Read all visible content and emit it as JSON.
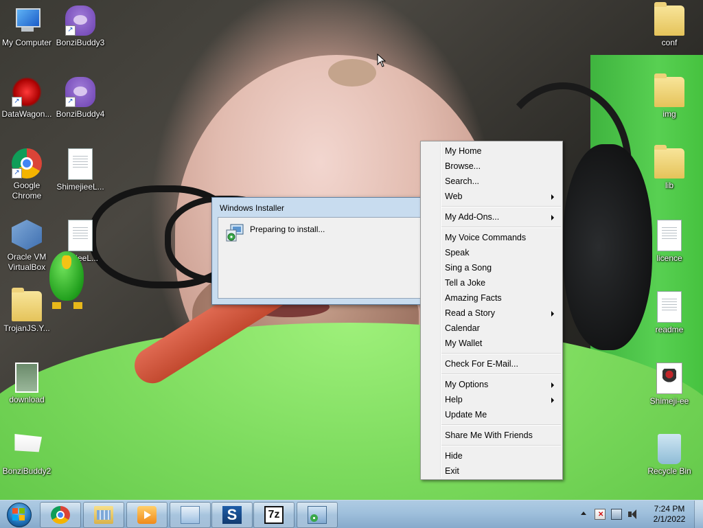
{
  "desktop": {
    "left_icons": [
      {
        "label": "My Computer",
        "icon": "computer-icon"
      },
      {
        "label": "BonziBuddy3",
        "icon": "bonzi-icon"
      },
      {
        "label": "DataWagon...",
        "icon": "web-icon"
      },
      {
        "label": "BonziBuddy4",
        "icon": "bonzi-icon"
      },
      {
        "label": "Google Chrome",
        "icon": "chrome-icon"
      },
      {
        "label": "ShimejieeL...",
        "icon": "document-icon"
      },
      {
        "label": "Oracle VM VirtualBox",
        "icon": "virtualbox-icon"
      },
      {
        "label": "...ejieeL...",
        "icon": "document-icon"
      },
      {
        "label": "TrojanJS.Y...",
        "icon": "folder-icon"
      },
      {
        "label": "download",
        "icon": "photo-icon"
      },
      {
        "label": "BonziBuddy2",
        "icon": "flag-icon"
      }
    ],
    "right_icons": [
      {
        "label": "conf",
        "icon": "folder-icon"
      },
      {
        "label": "img",
        "icon": "folder-icon"
      },
      {
        "label": "lib",
        "icon": "folder-icon"
      },
      {
        "label": "licence",
        "icon": "document-icon"
      },
      {
        "label": "readme",
        "icon": "document-icon"
      },
      {
        "label": "Shimeji-ee",
        "icon": "shimeji-icon"
      },
      {
        "label": "Recycle Bin",
        "icon": "recycle-bin-icon"
      }
    ]
  },
  "installer": {
    "title": "Windows Installer",
    "message": "Preparing to install..."
  },
  "context_menu": {
    "groups": [
      [
        {
          "label": "My Home",
          "submenu": false
        },
        {
          "label": "Browse...",
          "submenu": false
        },
        {
          "label": "Search...",
          "submenu": false
        },
        {
          "label": "Web",
          "submenu": true
        }
      ],
      [
        {
          "label": "My Add-Ons...",
          "submenu": true
        }
      ],
      [
        {
          "label": "My Voice Commands",
          "submenu": false
        },
        {
          "label": "Speak",
          "submenu": false
        },
        {
          "label": "Sing a Song",
          "submenu": false
        },
        {
          "label": "Tell a Joke",
          "submenu": false
        },
        {
          "label": "Amazing Facts",
          "submenu": false
        },
        {
          "label": "Read a Story",
          "submenu": true
        },
        {
          "label": "Calendar",
          "submenu": false
        },
        {
          "label": "My Wallet",
          "submenu": false
        }
      ],
      [
        {
          "label": "Check For E-Mail...",
          "submenu": false
        }
      ],
      [
        {
          "label": "My Options",
          "submenu": true
        },
        {
          "label": "Help",
          "submenu": true
        },
        {
          "label": "Update Me",
          "submenu": false
        }
      ],
      [
        {
          "label": "Share Me With Friends",
          "submenu": false
        }
      ],
      [
        {
          "label": "Hide",
          "submenu": false
        },
        {
          "label": "Exit",
          "submenu": false
        }
      ]
    ]
  },
  "taskbar": {
    "pinned": [
      {
        "name": "chrome",
        "icon": "chrome-icon",
        "text": ""
      },
      {
        "name": "explorer",
        "icon": "explorer-icon",
        "text": ""
      },
      {
        "name": "media-player",
        "icon": "media-player-icon",
        "text": ""
      },
      {
        "name": "control-panel",
        "icon": "control-panel-icon",
        "text": ""
      },
      {
        "name": "s-app",
        "icon": "s-app-icon",
        "text": "S"
      },
      {
        "name": "7zip",
        "icon": "7zip-icon",
        "text": "7z"
      },
      {
        "name": "windows-installer",
        "icon": "installer-icon",
        "text": ""
      }
    ],
    "clock": {
      "time": "7:24 PM",
      "date": "2/1/2022"
    }
  }
}
